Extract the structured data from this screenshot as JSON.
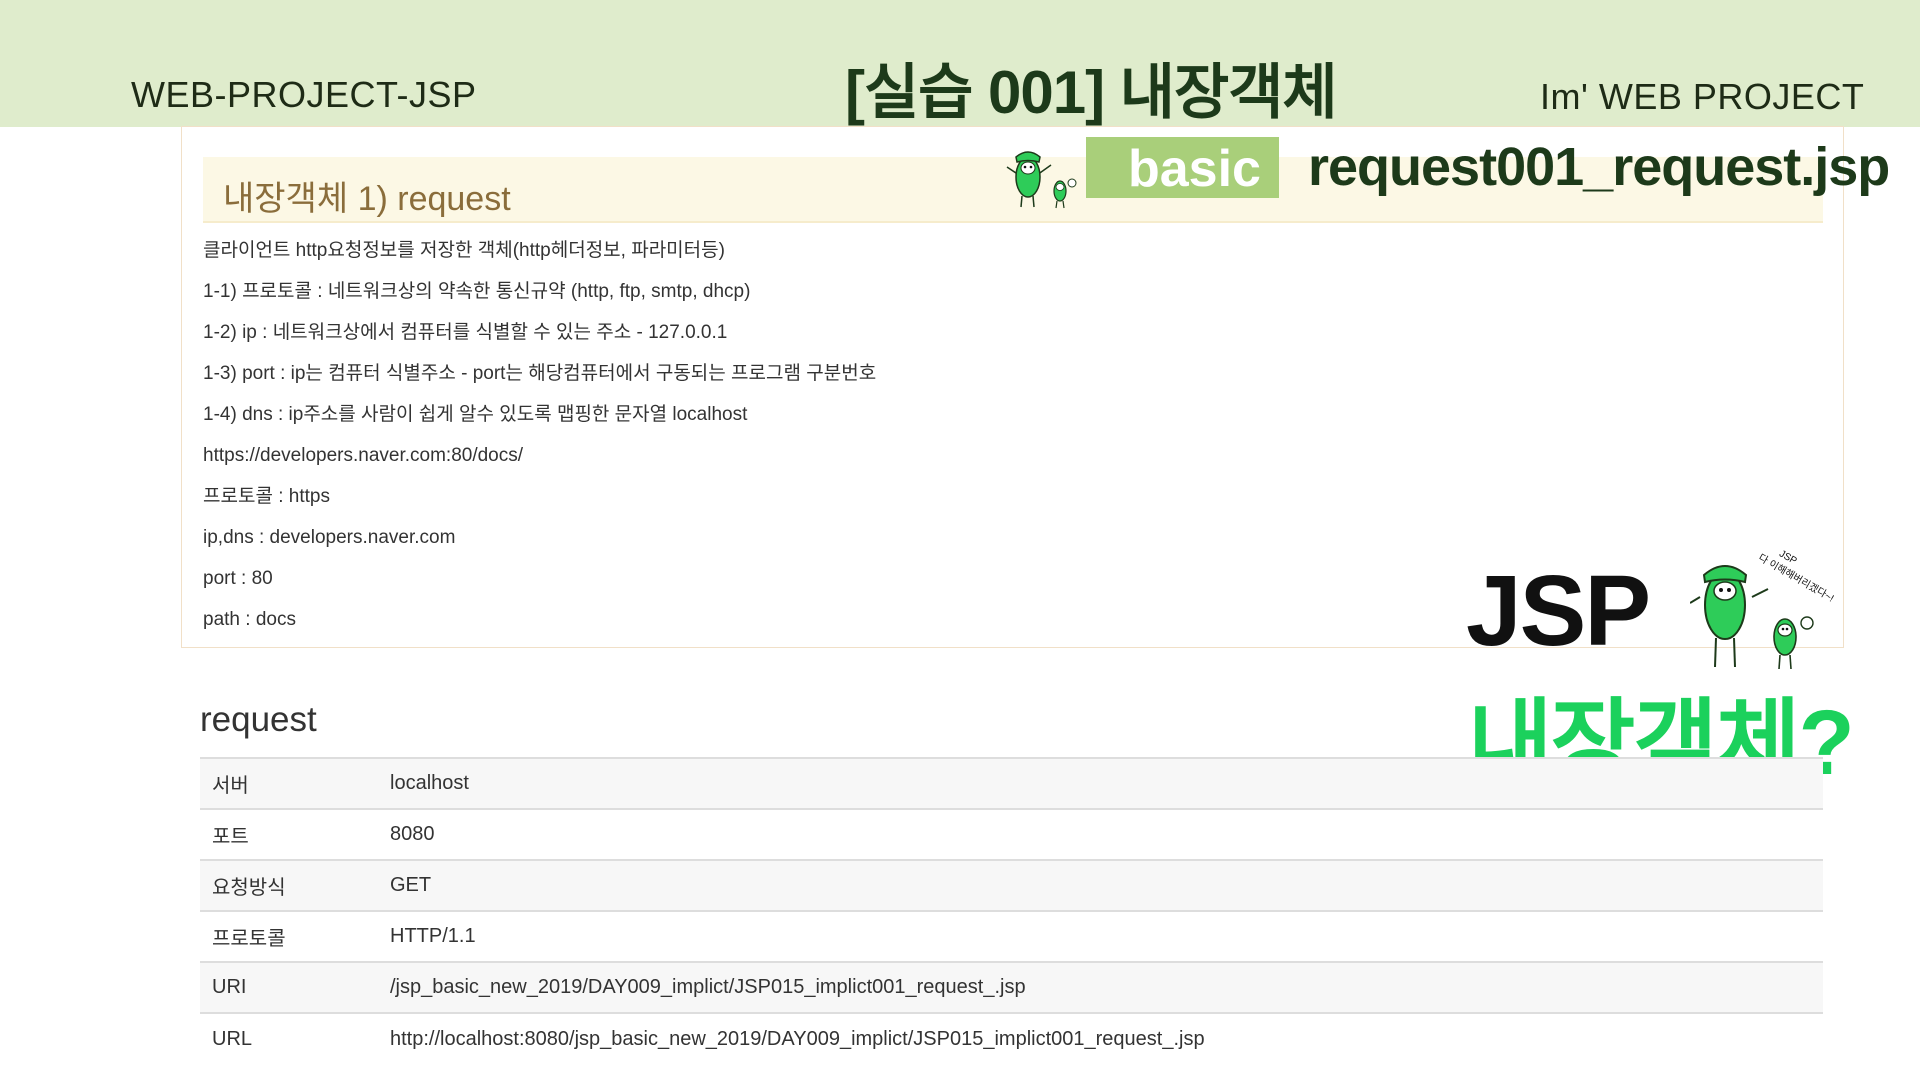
{
  "header": {
    "left": "WEB-PROJECT-JSP",
    "center": "[실습 001]  내장객체",
    "right": "Im'  WEB PROJECT"
  },
  "badge": {
    "label": "basic",
    "file_name": "request001_request.jsp",
    "mascot_sign": "JSP 다 이해해버리겠다~!"
  },
  "panel": {
    "title": "내장객체 1) request",
    "lines": [
      "클라이언트 http요청정보를 저장한 객체(http헤더정보, 파라미터등)",
      "1-1) 프로토콜 : 네트워크상의 약속한 통신규약 (http, ftp, smtp, dhcp)",
      "1-2) ip : 네트워크상에서 컴퓨터를 식별할 수 있는 주소 - 127.0.0.1",
      "1-3) port : ip는 컴퓨터 식별주소 - port는 해당컴퓨터에서 구동되는 프로그램 구분번호",
      "1-4) dns : ip주소를 사람이 쉽게 알수 있도록 맵핑한 문자열 localhost",
      "https://developers.naver.com:80/docs/",
      "프로토콜 : https",
      "ip,dns : developers.naver.com",
      "port : 80",
      "path : docs"
    ]
  },
  "side": {
    "jsp": "JSP",
    "question": "내장객체?",
    "mascot_sign": "JSP 다 이해해버리겠다~!"
  },
  "request_table": {
    "heading": "request",
    "rows": [
      {
        "key": "서버",
        "value": "localhost"
      },
      {
        "key": "포트",
        "value": "8080"
      },
      {
        "key": "요청방식",
        "value": "GET"
      },
      {
        "key": "프로토콜",
        "value": "HTTP/1.1"
      },
      {
        "key": "URI",
        "value": "/jsp_basic_new_2019/DAY009_implict/JSP015_implict001_request_.jsp"
      },
      {
        "key": "URL",
        "value": "http://localhost:8080/jsp_basic_new_2019/DAY009_implict/JSP015_implict001_request_.jsp"
      }
    ]
  },
  "colors": {
    "header_bg": "#dfeccc",
    "accent_green": "#1bd15c",
    "badge_green": "#a9cf7a",
    "panel_title_bg": "#fcf8e5",
    "panel_title_text": "#8a6d3b"
  }
}
